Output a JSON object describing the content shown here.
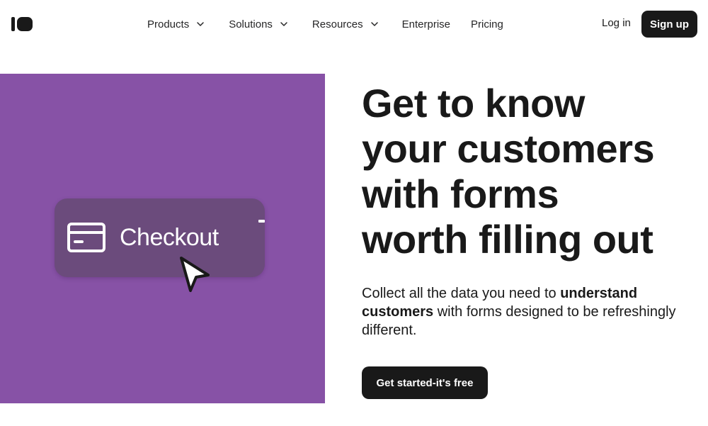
{
  "header": {
    "logo_icon": "brand-logo-icon",
    "nav": [
      {
        "label": "Products",
        "has_dropdown": true
      },
      {
        "label": "Solutions",
        "has_dropdown": true
      },
      {
        "label": "Resources",
        "has_dropdown": true
      },
      {
        "label": "Enterprise",
        "has_dropdown": false
      },
      {
        "label": "Pricing",
        "has_dropdown": false
      }
    ],
    "login_label": "Log in",
    "signup_label": "Sign up"
  },
  "hero": {
    "media": {
      "background_color": "#8752a6",
      "card_color": "#6b4b7c",
      "card_icon": "credit-card-icon",
      "card_label": "Checkout",
      "cursor_icon": "mouse-pointer-icon"
    },
    "headline_lines": [
      "Get to know",
      "your customers",
      "with forms",
      "worth filling out"
    ],
    "subtext": {
      "part1": "Collect all the data you need to ",
      "bold1": "understand customers",
      "part2": " with forms designed to be refreshingly different."
    },
    "cta_label": "Get started-it's free"
  },
  "colors": {
    "primary_dark": "#191919",
    "text": "#191919",
    "background": "#ffffff"
  }
}
